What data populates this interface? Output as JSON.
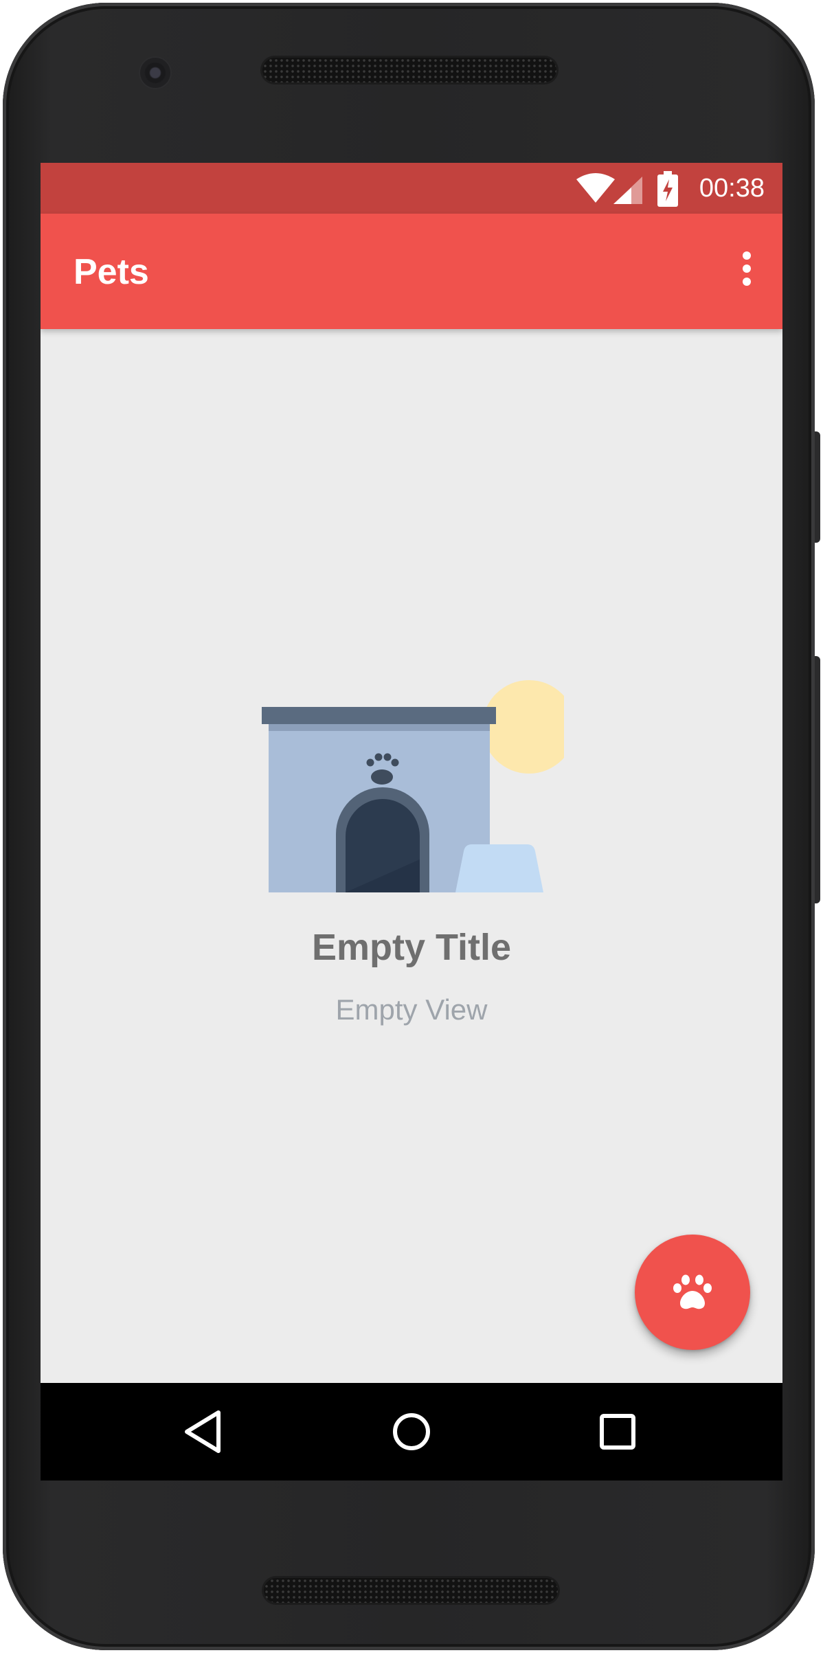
{
  "status_bar": {
    "time": "00:38",
    "icons": [
      "wifi-icon",
      "cell-signal-icon",
      "battery-charging-icon"
    ],
    "color": "#c2423e"
  },
  "app_bar": {
    "title": "Pets",
    "menu_icon": "more-vert-icon",
    "color": "#f0524d"
  },
  "empty_state": {
    "illustration": "dog-house-illustration",
    "title": "Empty Title",
    "subtitle": "Empty View"
  },
  "fab": {
    "icon": "paw-icon",
    "color": "#f0524d"
  },
  "nav_bar": {
    "buttons": [
      "back-icon",
      "home-icon",
      "recents-icon"
    ]
  }
}
